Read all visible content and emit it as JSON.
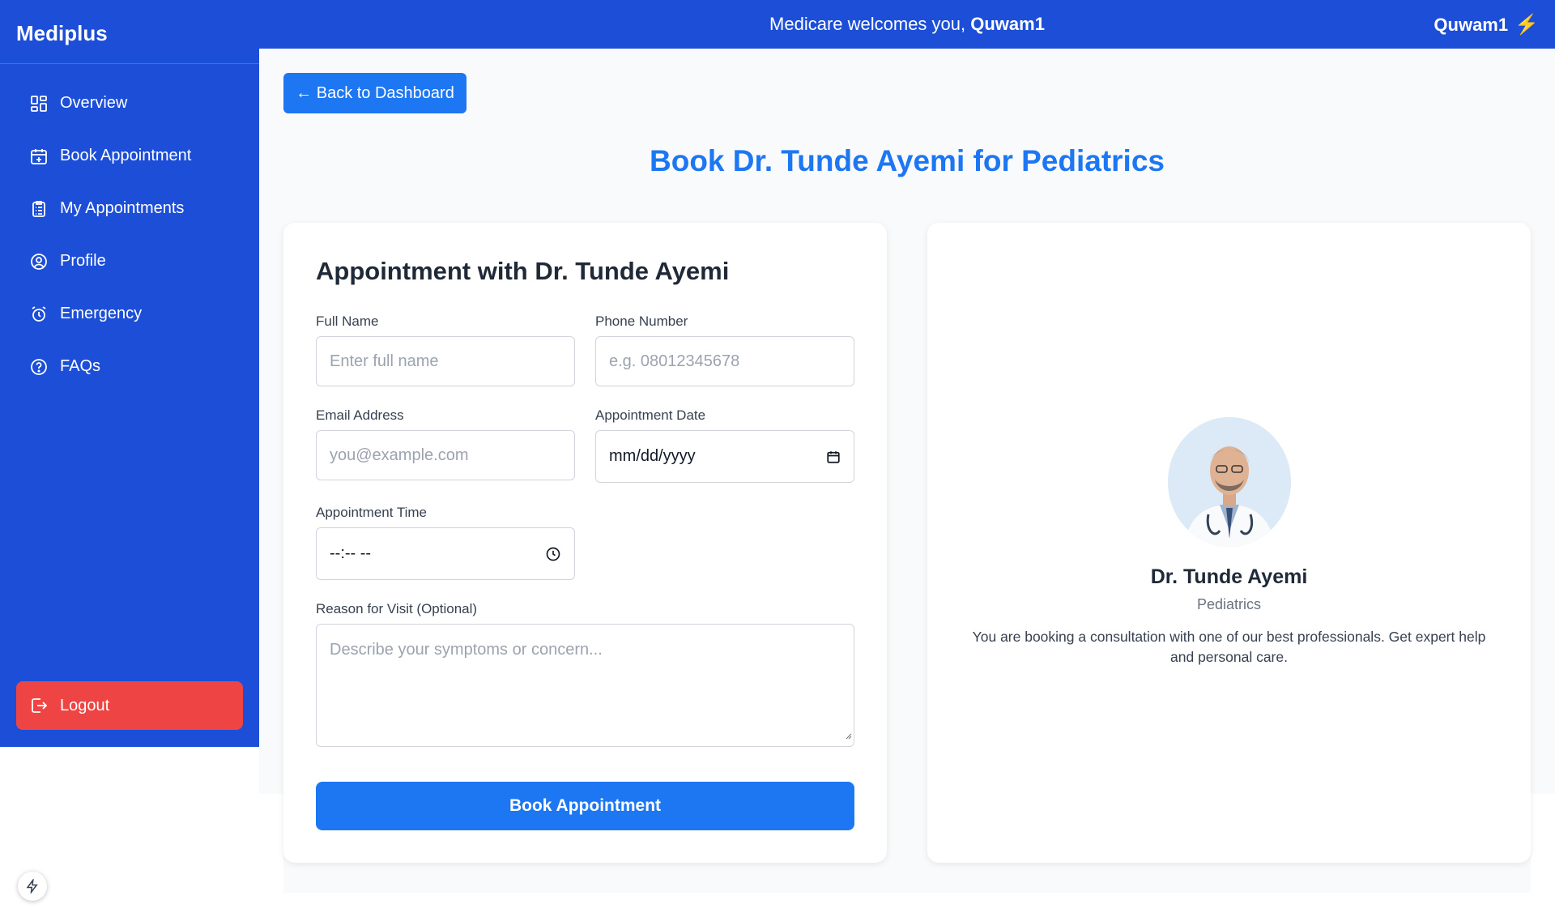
{
  "brand": "Mediplus",
  "header": {
    "welcome_prefix": "Medicare welcomes you, ",
    "welcome_user": "Quwam1",
    "username": "Quwam1",
    "user_icon": "lightning-icon"
  },
  "sidebar": {
    "items": [
      {
        "label": "Overview",
        "icon": "grid-icon"
      },
      {
        "label": "Book Appointment",
        "icon": "calendar-plus-icon"
      },
      {
        "label": "My Appointments",
        "icon": "clipboard-list-icon"
      },
      {
        "label": "Profile",
        "icon": "user-circle-icon"
      },
      {
        "label": "Emergency",
        "icon": "alarm-clock-icon"
      },
      {
        "label": "FAQs",
        "icon": "question-circle-icon"
      }
    ],
    "logout_label": "Logout"
  },
  "main": {
    "back_label": "← Back to Dashboard",
    "page_title": "Book Dr. Tunde Ayemi for Pediatrics"
  },
  "form": {
    "title": "Appointment with Dr. Tunde Ayemi",
    "full_name": {
      "label": "Full Name",
      "placeholder": "Enter full name"
    },
    "phone": {
      "label": "Phone Number",
      "placeholder": "e.g. 08012345678"
    },
    "email": {
      "label": "Email Address",
      "placeholder": "you@example.com"
    },
    "date": {
      "label": "Appointment Date",
      "value": "mm/dd/yyyy"
    },
    "time": {
      "label": "Appointment Time",
      "value": "--:-- --"
    },
    "reason": {
      "label": "Reason for Visit (Optional)",
      "placeholder": "Describe your symptoms or concern..."
    },
    "submit_label": "Book Appointment"
  },
  "doctor": {
    "name": "Dr. Tunde Ayemi",
    "specialty": "Pediatrics",
    "description": "You are booking a consultation with one of our best professionals. Get expert help and personal care."
  },
  "colors": {
    "primary": "#1d4ed8",
    "accent": "#1d77f2",
    "danger": "#ef4444",
    "background": "#f9fafb"
  }
}
